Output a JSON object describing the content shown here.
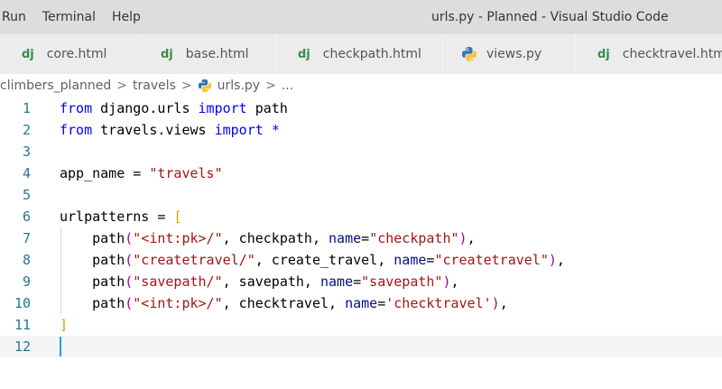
{
  "menu": {
    "items": [
      "Run",
      "Terminal",
      "Help"
    ]
  },
  "window_title": "urls.py - Planned - Visual Studio Code",
  "tabs": [
    {
      "icon": "dj",
      "label": "core.html"
    },
    {
      "icon": "dj",
      "label": "base.html"
    },
    {
      "icon": "dj",
      "label": "checkpath.html"
    },
    {
      "icon": "python",
      "label": "views.py"
    },
    {
      "icon": "dj",
      "label": "checktravel.html"
    }
  ],
  "breadcrumb": {
    "parts": [
      "climbers_planned",
      "travels",
      "urls.py",
      "..."
    ],
    "separator": ">"
  },
  "editor": {
    "line_numbers": [
      "1",
      "2",
      "3",
      "4",
      "5",
      "6",
      "7",
      "8",
      "9",
      "10",
      "11",
      "12"
    ],
    "current_line": "12",
    "lines": [
      [
        {
          "t": "from",
          "c": "kw"
        },
        {
          "t": " django.urls ",
          "c": ""
        },
        {
          "t": "import",
          "c": "kw"
        },
        {
          "t": " path",
          "c": ""
        }
      ],
      [
        {
          "t": "from",
          "c": "kw"
        },
        {
          "t": " travels.views ",
          "c": ""
        },
        {
          "t": "import",
          "c": "kw"
        },
        {
          "t": " ",
          "c": ""
        },
        {
          "t": "*",
          "c": "kw"
        }
      ],
      [],
      [
        {
          "t": "app_name = ",
          "c": ""
        },
        {
          "t": "\"travels\"",
          "c": "str"
        }
      ],
      [],
      [
        {
          "t": "urlpatterns = ",
          "c": ""
        },
        {
          "t": "[",
          "c": "br1"
        }
      ],
      [
        {
          "t": "    path",
          "c": ""
        },
        {
          "t": "(",
          "c": "br2"
        },
        {
          "t": "\"<int:pk>/\"",
          "c": "str"
        },
        {
          "t": ", checkpath, ",
          "c": ""
        },
        {
          "t": "name",
          "c": "param"
        },
        {
          "t": "=",
          "c": ""
        },
        {
          "t": "\"checkpath\"",
          "c": "str"
        },
        {
          "t": ")",
          "c": "br2"
        },
        {
          "t": ",",
          "c": ""
        }
      ],
      [
        {
          "t": "    path",
          "c": ""
        },
        {
          "t": "(",
          "c": "br2"
        },
        {
          "t": "\"createtravel/\"",
          "c": "str"
        },
        {
          "t": ", create_travel, ",
          "c": ""
        },
        {
          "t": "name",
          "c": "param"
        },
        {
          "t": "=",
          "c": ""
        },
        {
          "t": "\"createtravel\"",
          "c": "str"
        },
        {
          "t": ")",
          "c": "br2"
        },
        {
          "t": ",",
          "c": ""
        }
      ],
      [
        {
          "t": "    path",
          "c": ""
        },
        {
          "t": "(",
          "c": "br2"
        },
        {
          "t": "\"savepath/\"",
          "c": "str"
        },
        {
          "t": ", savepath, ",
          "c": ""
        },
        {
          "t": "name",
          "c": "param"
        },
        {
          "t": "=",
          "c": ""
        },
        {
          "t": "\"savepath\"",
          "c": "str"
        },
        {
          "t": ")",
          "c": "br2"
        },
        {
          "t": ",",
          "c": ""
        }
      ],
      [
        {
          "t": "    path",
          "c": ""
        },
        {
          "t": "(",
          "c": "br2"
        },
        {
          "t": "\"<int:pk>/\"",
          "c": "str"
        },
        {
          "t": ", checktravel, ",
          "c": ""
        },
        {
          "t": "name",
          "c": "param"
        },
        {
          "t": "=",
          "c": ""
        },
        {
          "t": "'checktravel'",
          "c": "str"
        },
        {
          "t": ")",
          "c": "br2"
        },
        {
          "t": ",",
          "c": ""
        }
      ],
      [
        {
          "t": "]",
          "c": "br1"
        }
      ],
      []
    ]
  },
  "colors": {
    "keyword": "#0000ff",
    "string": "#a31515",
    "parameter": "#001080",
    "bracket_level1": "#d4a300",
    "bracket_level2": "#a000a0",
    "line_number": "#237893",
    "django_icon": "#3e8a4c"
  }
}
